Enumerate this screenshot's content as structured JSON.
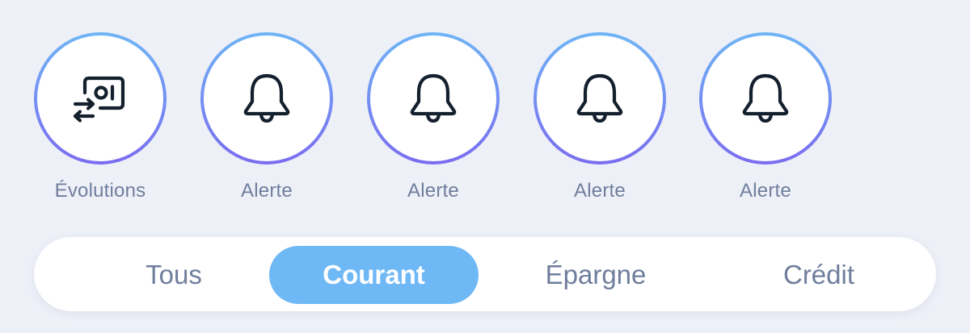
{
  "colors": {
    "background": "#eef0f8",
    "ring_gradient_top": "#6fb5f5",
    "ring_gradient_bottom": "#7a6cf0",
    "active_tab": "#6fb8f6",
    "text_muted": "#6f7e9c",
    "icon_stroke": "#14202e"
  },
  "stories": [
    {
      "label": "Évolutions",
      "icon": "evolutions-icon"
    },
    {
      "label": "Alerte",
      "icon": "bell-icon"
    },
    {
      "label": "Alerte",
      "icon": "bell-icon"
    },
    {
      "label": "Alerte",
      "icon": "bell-icon"
    },
    {
      "label": "Alerte",
      "icon": "bell-icon"
    }
  ],
  "tabs": [
    {
      "label": "Tous",
      "active": false
    },
    {
      "label": "Courant",
      "active": true
    },
    {
      "label": "Épargne",
      "active": false
    },
    {
      "label": "Crédit",
      "active": false
    }
  ]
}
